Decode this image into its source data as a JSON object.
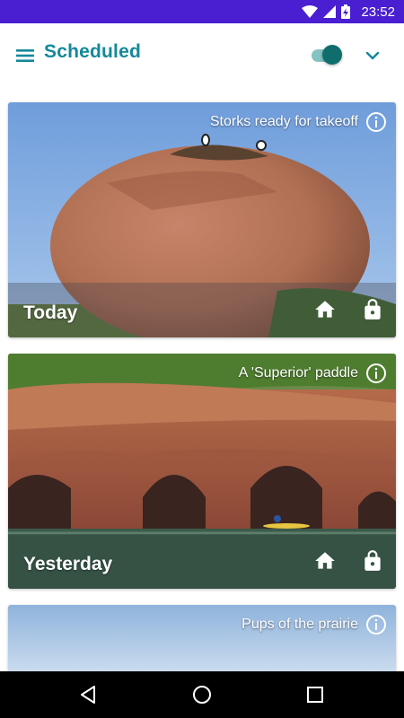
{
  "status_bar": {
    "time": "23:52",
    "icons": [
      "wifi-icon",
      "signal-icon",
      "battery-charging-icon"
    ],
    "background": "#4a1ed1"
  },
  "app_bar": {
    "title": "Scheduled",
    "menu_icon": "hamburger-menu-icon",
    "toggle_on": true,
    "dropdown_icon": "chevron-down-icon",
    "accent_color": "#13899a"
  },
  "cards": [
    {
      "caption": "Storks ready for takeoff",
      "day": "Today",
      "scene": "storks-rock"
    },
    {
      "caption": "A 'Superior' paddle",
      "day": "Yesterday",
      "scene": "sea-caves"
    },
    {
      "caption": "Pups of the prairie",
      "day": "",
      "scene": "prairie-sky"
    }
  ],
  "card_icons": {
    "info": "info-icon",
    "home": "home-icon",
    "lock": "lock-icon"
  },
  "nav_bar": {
    "buttons": [
      "back-icon",
      "home-circle-icon",
      "recents-square-icon"
    ]
  }
}
